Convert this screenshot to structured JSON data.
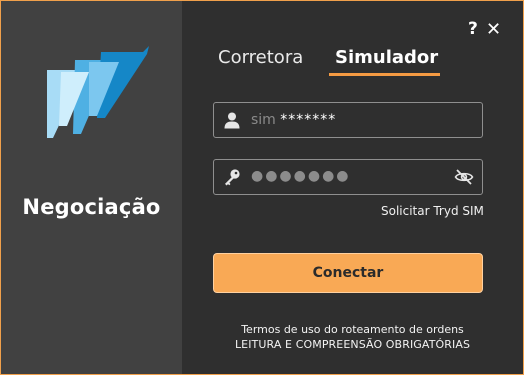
{
  "window": {
    "help_label": "?",
    "close_label": "✕",
    "accent_color": "#f59b43",
    "border_color": "#f0a04b"
  },
  "left_panel": {
    "logo_icon": "triple-arrow-logo-icon",
    "brand_title": "Negociação"
  },
  "tabs": [
    {
      "label": "Corretora",
      "selected": false
    },
    {
      "label": "Simulador",
      "selected": true
    }
  ],
  "login": {
    "username_prefix": "sim",
    "username_value": "*******",
    "username_icon": "user-icon",
    "password_value": "●●●●●●●",
    "password_icon": "key-icon",
    "toggle_visibility_icon": "eye-slash-icon",
    "request_link": "Solicitar Tryd SIM",
    "submit_label": "Conectar"
  },
  "footer": {
    "terms_line1": "Termos de uso do roteamento de ordens",
    "terms_line2": "LEITURA E COMPREENSÃO OBRIGATÓRIAS"
  }
}
